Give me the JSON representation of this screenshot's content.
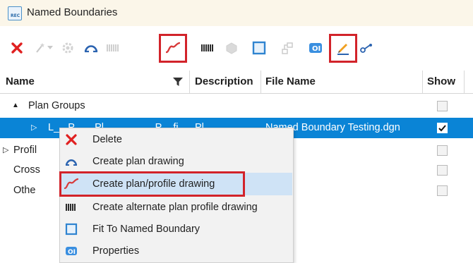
{
  "window": {
    "title": "Named Boundaries",
    "icon": "named-boundaries-rec-icon",
    "icon_caption": "REC"
  },
  "toolbar": {
    "buttons": [
      {
        "icon": "delete-x-icon",
        "state": "enabled"
      },
      {
        "icon": "wand-icon",
        "state": "disabled"
      },
      {
        "icon": "dropdown-arrow-icon",
        "state": "disabled"
      },
      {
        "icon": "gear-icon",
        "state": "disabled"
      },
      {
        "icon": "plan-drawing-icon",
        "state": "enabled"
      },
      {
        "icon": "alternate-bars-icon",
        "state": "disabled"
      },
      {
        "icon": "plan-profile-curve-icon",
        "state": "enabled",
        "highlighted": true
      },
      {
        "icon": "alternate-plan-profile-icon",
        "state": "enabled"
      },
      {
        "icon": "cube-icon",
        "state": "disabled"
      },
      {
        "icon": "fit-boundary-icon",
        "state": "enabled"
      },
      {
        "icon": "hierarchy-icon",
        "state": "disabled"
      },
      {
        "icon": "properties-icon",
        "state": "enabled"
      },
      {
        "icon": "pencil-icon",
        "state": "enabled",
        "highlighted": true
      },
      {
        "icon": "link-icon",
        "state": "enabled"
      }
    ]
  },
  "table": {
    "columns": {
      "name": "Name",
      "description": "Description",
      "file_name": "File Name",
      "show": "Show"
    },
    "rows": [
      {
        "label": "Plan Groups",
        "expand": "▲",
        "level": 0,
        "show": false
      },
      {
        "label": "L__ P___ Pl_____ ___ P__fi",
        "description": "Pl_____",
        "file": "Named Boundary Testing.dgn",
        "expand": "▷",
        "level": 1,
        "selected": true,
        "show": true
      },
      {
        "label": "Profil",
        "expand": "▷",
        "level": 0,
        "show": false
      },
      {
        "label": "Cross",
        "level": 0,
        "show": false
      },
      {
        "label": "Othe",
        "level": 0,
        "show": false
      }
    ]
  },
  "context_menu": {
    "items": [
      {
        "label": "Delete",
        "icon": "delete-x-icon"
      },
      {
        "label": "Create plan drawing",
        "icon": "plan-drawing-icon"
      },
      {
        "label": "Create plan/profile drawing",
        "icon": "plan-profile-curve-icon",
        "highlighted": true
      },
      {
        "label": "Create alternate plan profile drawing",
        "icon": "alternate-plan-profile-icon"
      },
      {
        "label": "Fit To Named Boundary",
        "icon": "fit-boundary-icon"
      },
      {
        "label": "Properties",
        "icon": "properties-icon"
      }
    ]
  },
  "colors": {
    "highlight_box": "#d2232a",
    "selection": "#0a84d6",
    "menu_hover": "#cfe3f6",
    "title_bar": "#fbf6e9"
  }
}
